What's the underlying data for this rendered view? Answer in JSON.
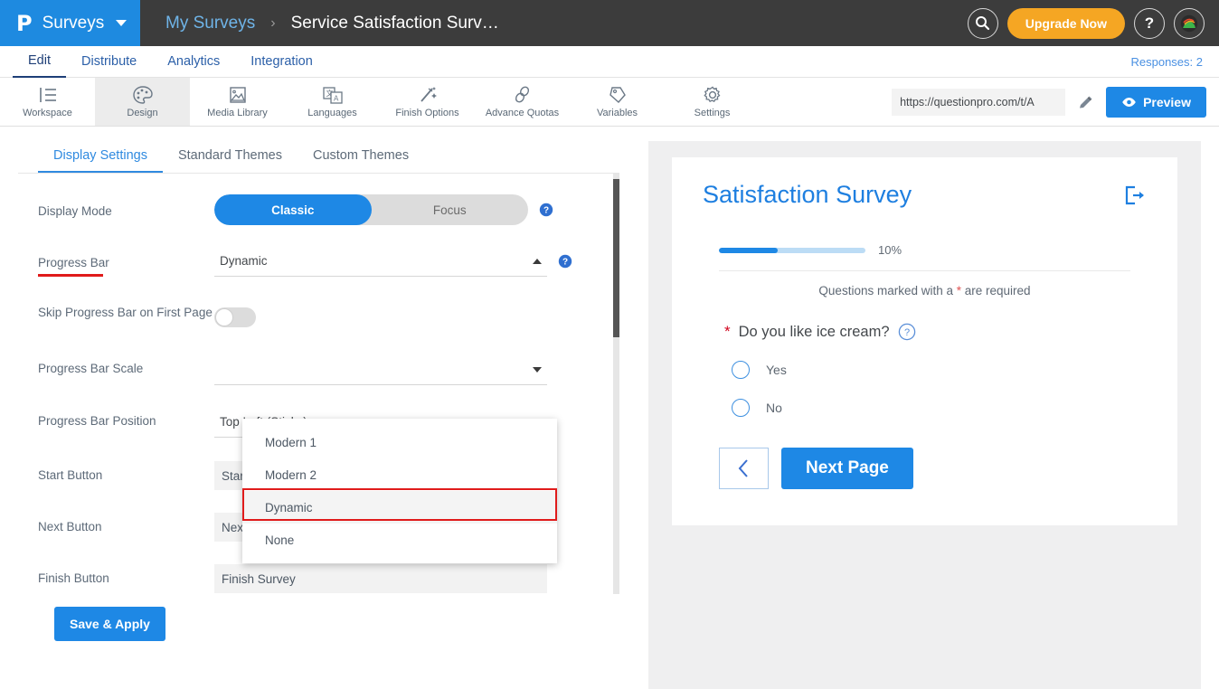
{
  "header": {
    "brand_logo": "P",
    "brand_text": "Surveys",
    "breadcrumb_parent": "My Surveys",
    "breadcrumb_sep": "›",
    "breadcrumb_current": "Service Satisfaction Surv…",
    "search_icon": "search-icon",
    "upgrade_label": "Upgrade Now",
    "help_icon": "question-mark-icon",
    "avatar_icon": "user-avatar-icon",
    "brand_color": "#1e8ae0",
    "upgrade_color": "#f5a623",
    "bar_color": "#3c3c3c"
  },
  "nav": {
    "tabs": [
      {
        "label": "Edit",
        "active": true
      },
      {
        "label": "Distribute",
        "active": false
      },
      {
        "label": "Analytics",
        "active": false
      },
      {
        "label": "Integration",
        "active": false
      }
    ],
    "responses": "Responses: 2"
  },
  "toolbar": {
    "items": [
      {
        "label": "Workspace",
        "icon": "workspace-icon",
        "active": false
      },
      {
        "label": "Design",
        "icon": "palette-icon",
        "active": true
      },
      {
        "label": "Media Library",
        "icon": "image-icon",
        "active": false
      },
      {
        "label": "Languages",
        "icon": "translate-icon",
        "active": false
      },
      {
        "label": "Finish Options",
        "icon": "magic-wand-icon",
        "active": false
      },
      {
        "label": "Advance Quotas",
        "icon": "chain-link-icon",
        "active": false
      },
      {
        "label": "Variables",
        "icon": "tag-icon",
        "active": false
      },
      {
        "label": "Settings",
        "icon": "gear-icon",
        "active": false
      }
    ],
    "url_value": "https://questionpro.com/t/A",
    "edit_icon": "pencil-icon",
    "preview_label": "Preview",
    "preview_icon": "eye-icon"
  },
  "panel": {
    "tabs": [
      {
        "label": "Display Settings",
        "active": true
      },
      {
        "label": "Standard Themes",
        "active": false
      },
      {
        "label": "Custom Themes",
        "active": false
      }
    ],
    "display_mode": {
      "label": "Display Mode",
      "options": [
        {
          "label": "Classic",
          "selected": true
        },
        {
          "label": "Focus",
          "selected": false
        }
      ]
    },
    "progress_bar": {
      "label": "Progress Bar",
      "value": "Dynamic",
      "open": true,
      "options": [
        {
          "label": "Modern 1",
          "highlighted": false
        },
        {
          "label": "Modern 2",
          "highlighted": false
        },
        {
          "label": "Dynamic",
          "highlighted": true
        },
        {
          "label": "None",
          "highlighted": false
        }
      ]
    },
    "skip_progress": {
      "label": "Skip Progress Bar on First Page",
      "on": false
    },
    "progress_scale": {
      "label": "Progress Bar Scale",
      "value": ""
    },
    "progress_position": {
      "label": "Progress Bar Position",
      "value": "Top Left (Sticky)"
    },
    "start_button": {
      "label": "Start Button",
      "value": "Start Survey"
    },
    "next_button": {
      "label": "Next Button",
      "value": "Next Page"
    },
    "finish_button": {
      "label": "Finish Button",
      "value": "Finish Survey"
    },
    "save_label": "Save & Apply",
    "help_icon": "help-circle-icon",
    "highlight_color": "#e01b1b"
  },
  "preview": {
    "title": "Satisfaction Survey",
    "exit_icon": "exit-arrow-icon",
    "progress_percent": "10%",
    "progress_value": 10,
    "required_note_pre": "Questions marked with a ",
    "required_note_ast": "*",
    "required_note_post": " are required",
    "question": {
      "required_mark": "*",
      "text": "Do you like ice cream?",
      "help_icon": "question-circle-icon",
      "options": [
        {
          "label": "Yes",
          "selected": false
        },
        {
          "label": "No",
          "selected": false
        }
      ]
    },
    "back_icon": "chevron-left-icon",
    "next_label": "Next Page"
  }
}
